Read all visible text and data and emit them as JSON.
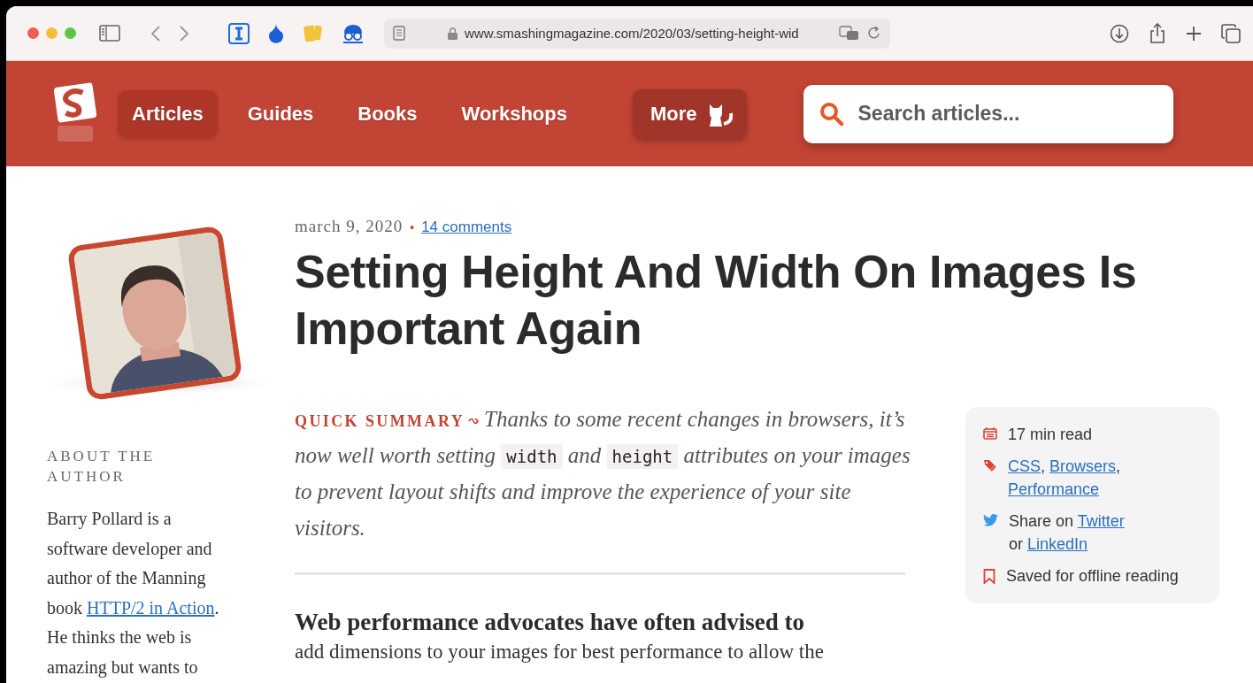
{
  "browser": {
    "url": "www.smashingmagazine.com/2020/03/setting-height-wid"
  },
  "nav": {
    "items": [
      {
        "label": "Articles",
        "selected": true
      },
      {
        "label": "Guides",
        "selected": false
      },
      {
        "label": "Books",
        "selected": false
      },
      {
        "label": "Workshops",
        "selected": false
      }
    ],
    "more": "More",
    "search": {
      "placeholder": "Search articles..."
    }
  },
  "sidebar": {
    "heading": "ABOUT THE AUTHOR",
    "bio": [
      {
        "kind": "text",
        "text": "Barry Pollard is a software developer and author of the Manning book "
      },
      {
        "kind": "link",
        "text": "HTTP/2 in Action"
      },
      {
        "kind": "text",
        "text": ". He thinks the web is amazing but wants to"
      }
    ]
  },
  "article": {
    "date": "march 9, 2020",
    "separator": "•",
    "comments": "14 comments",
    "title": "Setting Height And Width On Images Is Important Again",
    "summary_label": "QUICK SUMMARY",
    "summary": [
      {
        "kind": "text",
        "text": "Thanks to some recent changes in browsers, it’s now well worth setting "
      },
      {
        "kind": "code",
        "text": "width"
      },
      {
        "kind": "text",
        "text": " and "
      },
      {
        "kind": "code",
        "text": "height"
      },
      {
        "kind": "text",
        "text": " attributes on your images to prevent layout shifts and improve the experience of your site visitors."
      }
    ],
    "lead_bold": "Web performance advocates have often advised to",
    "lead_rest": "add dimensions to your images for best performance to allow the"
  },
  "info": [
    {
      "kind": "read_time",
      "parts": [
        {
          "kind": "text",
          "text": "17 min read"
        }
      ]
    },
    {
      "kind": "tags",
      "parts": [
        {
          "kind": "link",
          "text": "CSS"
        },
        {
          "kind": "text",
          "text": ", "
        },
        {
          "kind": "link",
          "text": "Browsers"
        },
        {
          "kind": "text",
          "text": ","
        },
        {
          "kind": "break"
        },
        {
          "kind": "link",
          "text": "Performance"
        }
      ]
    },
    {
      "kind": "share",
      "parts": [
        {
          "kind": "text",
          "text": "Share on "
        },
        {
          "kind": "link",
          "text": "Twitter"
        },
        {
          "kind": "break"
        },
        {
          "kind": "text",
          "text": "or "
        },
        {
          "kind": "link",
          "text": "LinkedIn"
        }
      ]
    },
    {
      "kind": "saved",
      "parts": [
        {
          "kind": "text",
          "text": "Saved for offline reading"
        }
      ]
    }
  ]
}
